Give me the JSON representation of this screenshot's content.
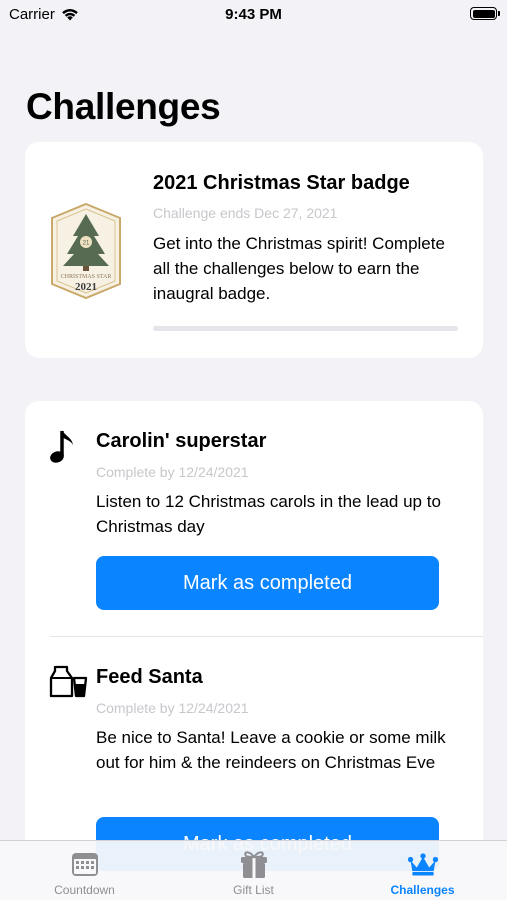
{
  "status_bar": {
    "carrier": "Carrier",
    "time": "9:43 PM"
  },
  "page_title": "Challenges",
  "badge": {
    "title": "2021 Christmas Star badge",
    "ends": "Challenge ends Dec 27, 2021",
    "description": "Get into the Christmas spirit! Complete all the challenges below to earn the inaugral badge.",
    "image_caption": "CHRISTMAS STAR",
    "image_year": "2021",
    "image_star": "21",
    "progress": 0
  },
  "challenges": [
    {
      "title": "Carolin' superstar",
      "due": "Complete by 12/24/2021",
      "description": "Listen to 12 Christmas carols in the lead up to Christmas day",
      "button": "Mark as completed",
      "icon": "music-note-icon"
    },
    {
      "title": "Feed Santa",
      "due": "Complete by 12/24/2021",
      "description": "Be nice to Santa! Leave a cookie or some milk out for him & the reindeers on Christmas Eve",
      "button": "Mark as completed",
      "icon": "milk-glass-icon"
    }
  ],
  "tabs": [
    {
      "label": "Countdown",
      "icon": "calendar-icon",
      "active": false
    },
    {
      "label": "Gift List",
      "icon": "gift-icon",
      "active": false
    },
    {
      "label": "Challenges",
      "icon": "crown-icon",
      "active": true
    }
  ],
  "colors": {
    "accent": "#0a84ff",
    "background": "#f2f2f7",
    "secondary_text": "#c7c7cc",
    "inactive_tab": "#8e8e93"
  }
}
